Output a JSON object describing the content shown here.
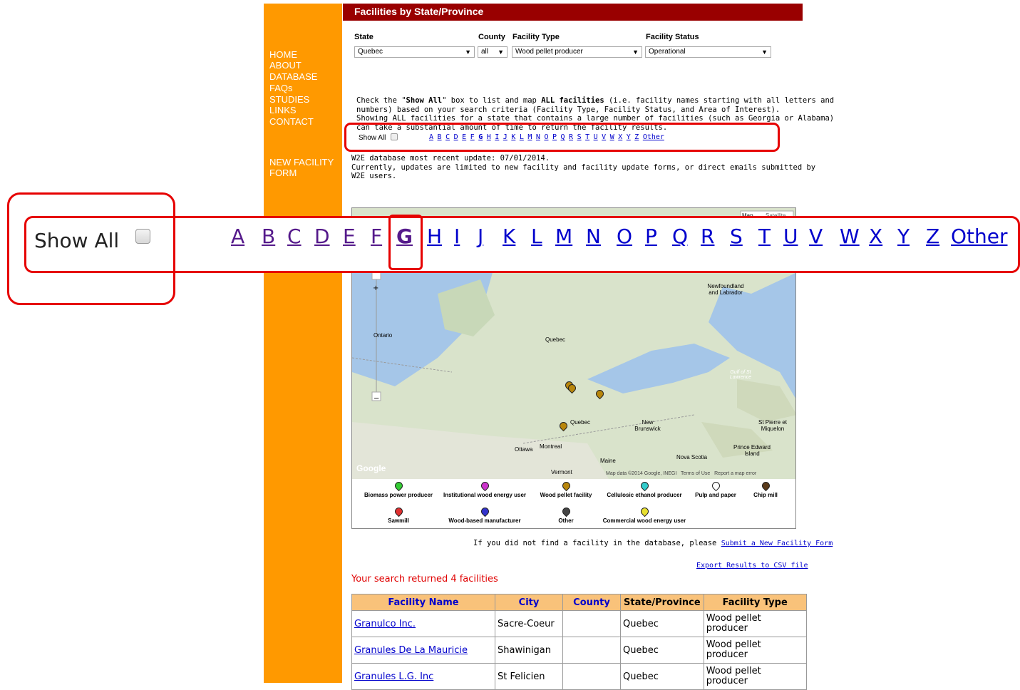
{
  "nav": {
    "items": [
      "HOME",
      "ABOUT",
      "DATABASE",
      "FAQs",
      "STUDIES",
      "LINKS",
      "CONTACT"
    ],
    "new_facility": [
      "NEW FACILITY",
      "FORM"
    ]
  },
  "header": {
    "title": "Facilities by State/Province"
  },
  "filters": {
    "state_label": "State",
    "state_value": "Quebec",
    "county_label": "County",
    "county_value": "all",
    "type_label": "Facility Type",
    "type_value": "Wood pellet producer",
    "status_label": "Facility Status",
    "status_value": "Operational"
  },
  "info": {
    "line1a": "Check the \"",
    "line1b": "Show All",
    "line1c": "\" box to list and map ",
    "line1d": "ALL facilities",
    "line1e": " (i.e. facility names starting with all letters and",
    "line2": "numbers) based on your search criteria (Facility Type, Facility Status, and Area of Interest).",
    "line3": "Showing ALL facilities for a state that contains a large number of facilities (such as Georgia or Alabama)",
    "line4": "can take a substantial amount of time to return the facility results."
  },
  "show_all_label": "Show All",
  "letters": [
    "A",
    "B",
    "C",
    "D",
    "E",
    "F",
    "G",
    "H",
    "I",
    "J",
    "K",
    "L",
    "M",
    "N",
    "O",
    "P",
    "Q",
    "R",
    "S",
    "T",
    "U",
    "V",
    "W",
    "X",
    "Y",
    "Z",
    "Other"
  ],
  "selected_letter": "G",
  "update": {
    "line1": "W2E database most recent update: 07/01/2014.",
    "line2": "Currently, updates are limited to new facility and facility update forms, or direct emails submitted by",
    "line3": "W2E users."
  },
  "map": {
    "type_buttons": [
      "Map",
      "Satellite"
    ],
    "labels": [
      "Newfoundland and Labrador",
      "Ontario",
      "Quebec",
      "Gulf of St Lawrence",
      "Quebec",
      "New Brunswick",
      "St Pierre et Miquelon",
      "Ottawa",
      "Montreal",
      "Prince Edward Island",
      "Nova Scotia",
      "Maine",
      "Vermont"
    ],
    "attribution": "Map data ©2014 Google, INEGI",
    "terms": "Terms of Use",
    "report": "Report a map error",
    "google": "Google",
    "legend": [
      {
        "label": "Biomass power producer",
        "color": "#33cc33"
      },
      {
        "label": "Institutional wood energy user",
        "color": "#cc33cc"
      },
      {
        "label": "Wood pellet facility",
        "color": "#b8860b"
      },
      {
        "label": "Cellulosic ethanol producer",
        "color": "#33cccc"
      },
      {
        "label": "Pulp and paper",
        "color": "#ffffff"
      },
      {
        "label": "Chip mill",
        "color": "#5a3a1a"
      },
      {
        "label": "Sawmill",
        "color": "#e03030"
      },
      {
        "label": "Wood-based manufacturer",
        "color": "#3333cc"
      },
      {
        "label": "Other",
        "color": "#444444"
      },
      {
        "label": "Commercial wood energy user",
        "color": "#e8e030"
      }
    ]
  },
  "notfound": {
    "text": "If you did not find a facility in the database, please ",
    "link": "Submit a New Facility Form"
  },
  "export": "Export Results to CSV file",
  "results_summary": "Your search returned 4 facilities",
  "table": {
    "headers": [
      "Facility Name",
      "City",
      "County",
      "State/Province",
      "Facility Type"
    ],
    "rows": [
      [
        "Granulco Inc.",
        "Sacre-Coeur",
        "",
        "Quebec",
        "Wood pellet producer"
      ],
      [
        "Granules De La Mauricie",
        "Shawinigan",
        "",
        "Quebec",
        "Wood pellet producer"
      ],
      [
        "Granules L.G. Inc",
        "St Felicien",
        "",
        "Quebec",
        "Wood pellet producer"
      ]
    ]
  },
  "colors": {
    "sidebar": "#ff9900",
    "header": "#990000",
    "highlight": "#e60000",
    "link": "#0000cc"
  }
}
